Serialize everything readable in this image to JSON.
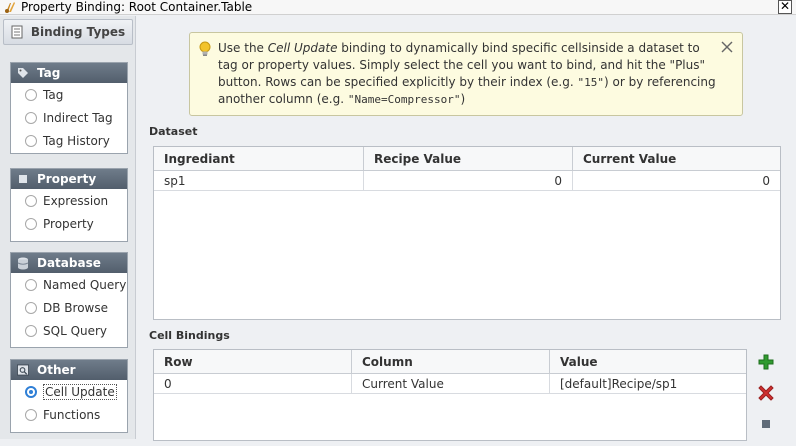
{
  "window": {
    "title": "Property Binding: Root Container.Table"
  },
  "binding_types": {
    "header": "Binding Types",
    "groups": [
      {
        "label": "Tag",
        "icon": "tag-icon",
        "options": [
          "Tag",
          "Indirect Tag",
          "Tag History"
        ]
      },
      {
        "label": "Property",
        "icon": "property-icon",
        "options": [
          "Expression",
          "Property"
        ]
      },
      {
        "label": "Database",
        "icon": "database-icon",
        "options": [
          "Named Query",
          "DB Browse",
          "SQL Query"
        ]
      },
      {
        "label": "Other",
        "icon": "query-icon",
        "options": [
          "Cell Update",
          "Functions"
        ]
      }
    ],
    "selected": "Cell Update"
  },
  "tip": {
    "p1": "Use the ",
    "em": "Cell Update",
    "p2": " binding to dynamically bind specific cellsinside a dataset to tag or property values. Simply select the cell you want to bind, and hit the \"Plus\" button. Rows can be specified explicitly by their index (e.g. ",
    "code1": "\"15\"",
    "p3": ") or by referencing another column (e.g. ",
    "code2": "\"Name=Compressor\"",
    "p4": ")"
  },
  "dataset": {
    "label": "Dataset",
    "columns": [
      "Ingrediant",
      "Recipe Value",
      "Current Value"
    ],
    "rows": [
      [
        "sp1",
        "0",
        "0"
      ]
    ]
  },
  "cell_bindings": {
    "label": "Cell Bindings",
    "columns": [
      "Row",
      "Column",
      "Value"
    ],
    "rows": [
      [
        "0",
        "Current Value",
        "[default]Recipe/sp1"
      ]
    ]
  },
  "colors": {
    "accent": "#2f7fd6",
    "add": "#2f9a2f",
    "remove": "#d03030"
  }
}
